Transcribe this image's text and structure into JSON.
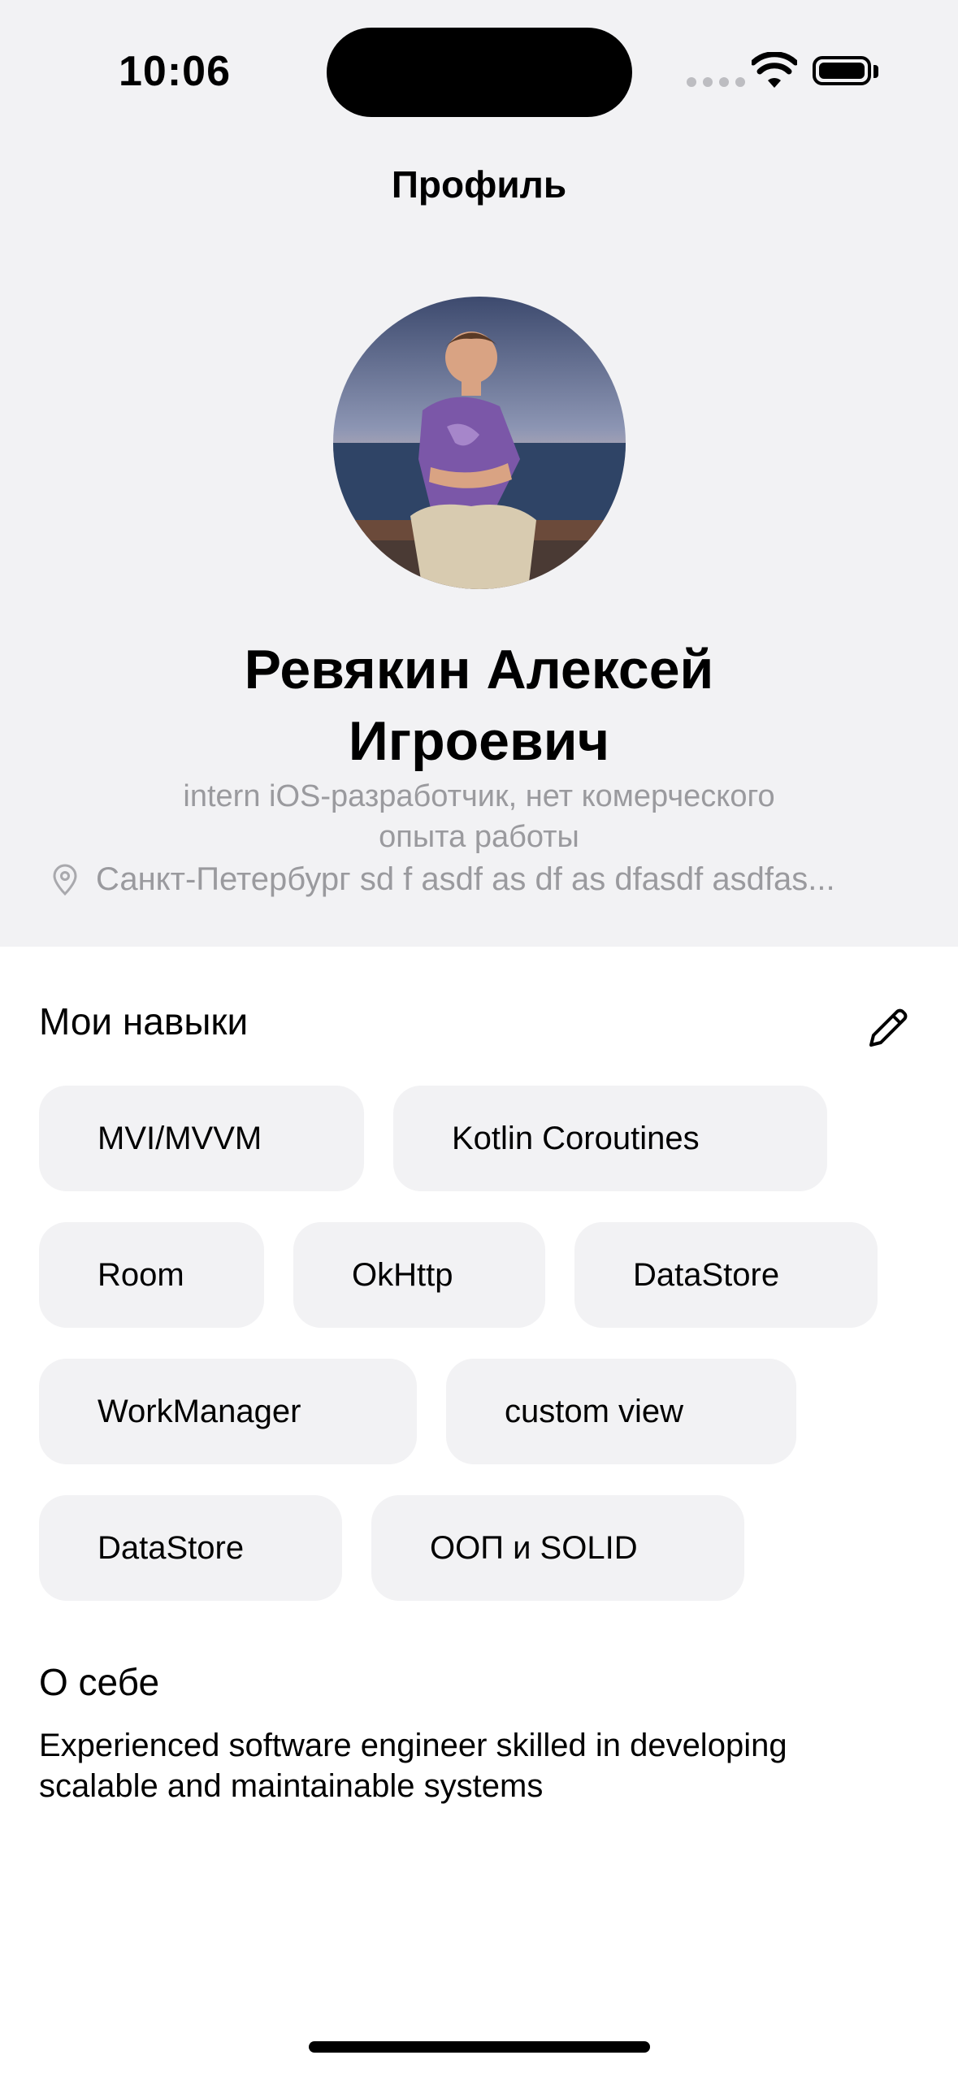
{
  "status_bar": {
    "time": "10:06"
  },
  "nav": {
    "title": "Профиль"
  },
  "profile": {
    "name_line1": "Ревякин Алексей",
    "name_line2": "Игроевич",
    "role_line1": "intern iOS-разработчик, нет комерческого",
    "role_line2": "опыта работы",
    "location": "Санкт-Петербург sd f asdf as df as dfasdf asdfas..."
  },
  "skills": {
    "title": "Мои навыки",
    "items": [
      "MVI/MVVM",
      "Kotlin Coroutines",
      "Room",
      "OkHttp",
      "DataStore",
      "WorkManager",
      "custom view",
      "DataStore",
      "ООП и SOLID"
    ]
  },
  "about": {
    "title": "О себе",
    "text_line1": "Experienced software engineer skilled in developing",
    "text_line2": "scalable and maintainable systems"
  },
  "icons": {
    "location": "location-pin-icon",
    "edit": "pencil-icon",
    "wifi": "wifi-icon",
    "battery": "battery-icon"
  },
  "colors": {
    "header_bg": "#f2f2f4",
    "chip_bg": "#f2f2f4",
    "secondary_text": "#9a9a9e"
  }
}
